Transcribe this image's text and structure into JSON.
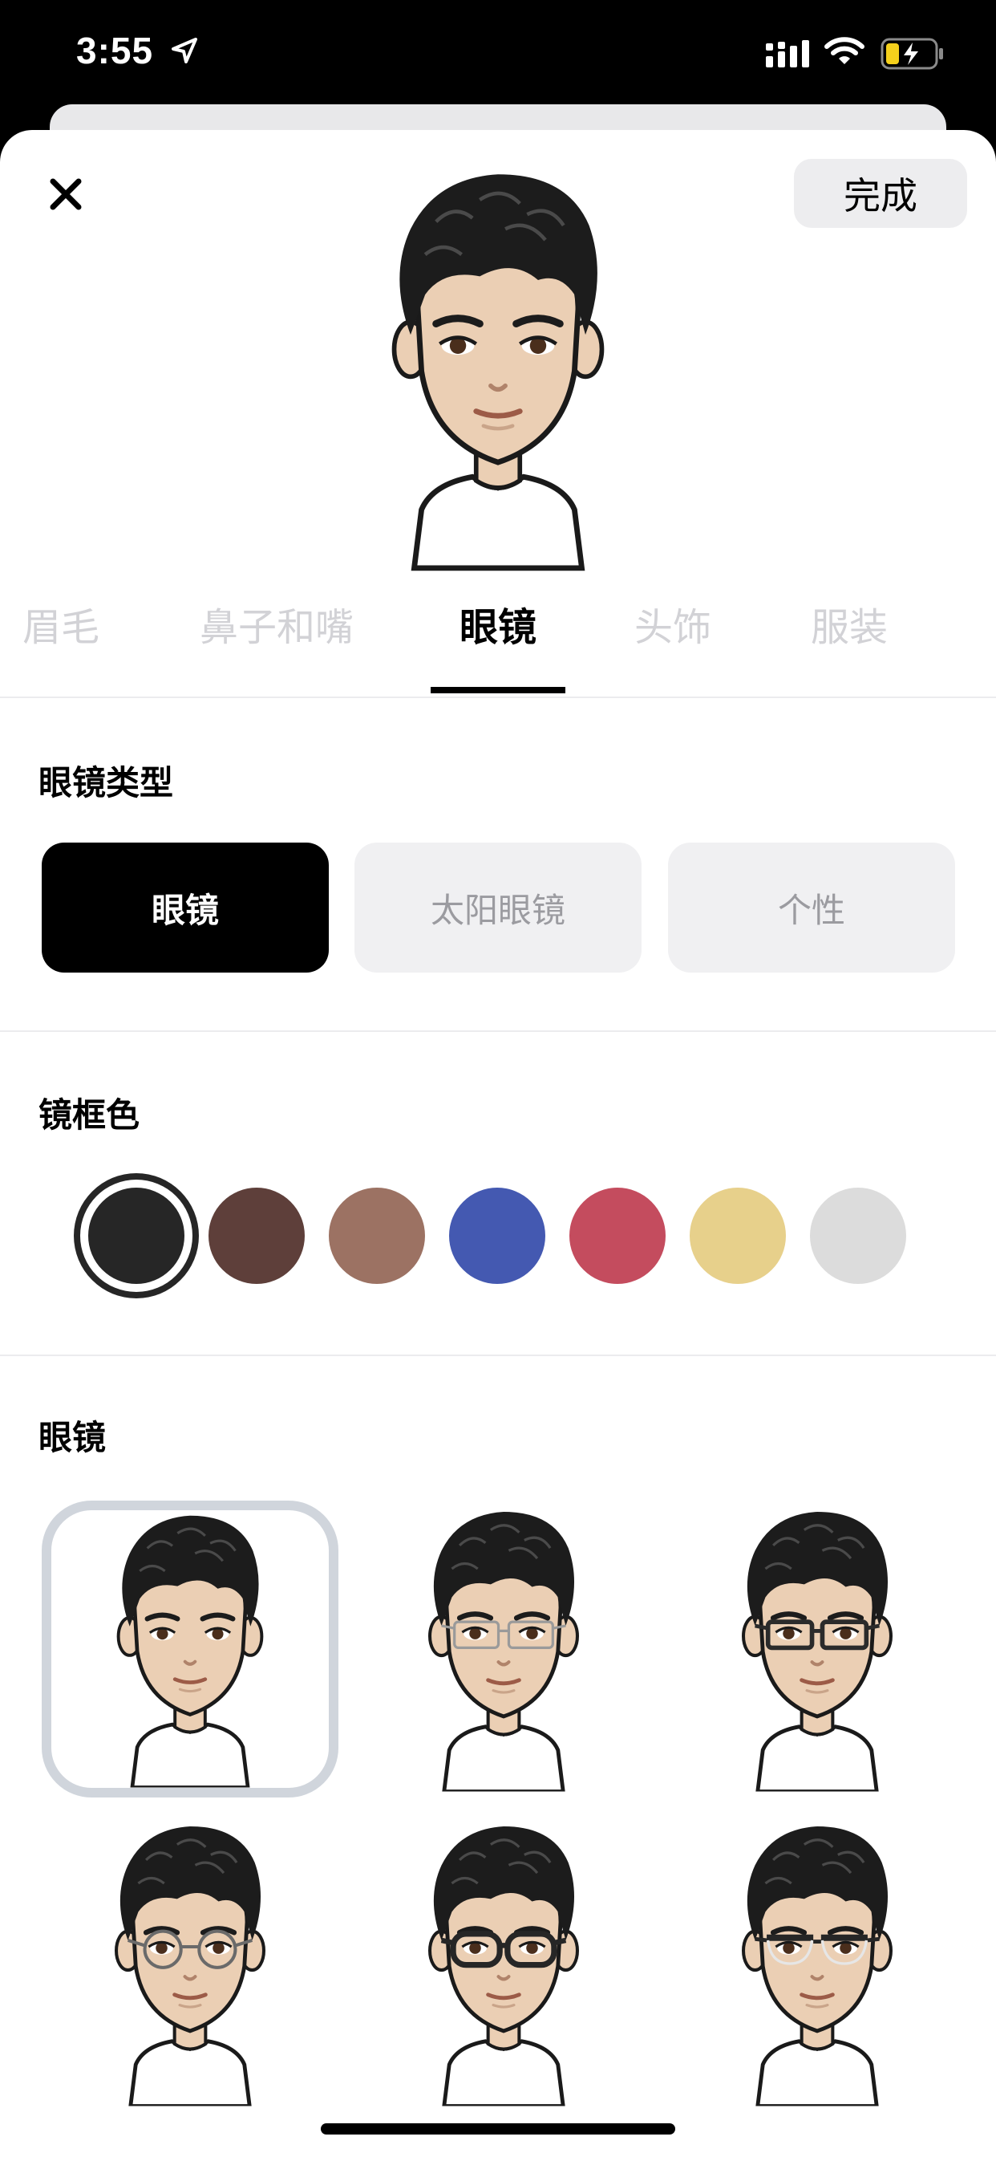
{
  "status": {
    "time": "3:55"
  },
  "header": {
    "done_label": "完成"
  },
  "tabs": [
    {
      "label": "眉毛",
      "active": false
    },
    {
      "label": "鼻子和嘴",
      "active": false
    },
    {
      "label": "眼镜",
      "active": true
    },
    {
      "label": "头饰",
      "active": false
    },
    {
      "label": "服装",
      "active": false
    }
  ],
  "glasses_type": {
    "title": "眼镜类型",
    "options": [
      {
        "label": "眼镜",
        "selected": true
      },
      {
        "label": "太阳眼镜",
        "selected": false
      },
      {
        "label": "个性",
        "selected": false
      }
    ]
  },
  "frame_color": {
    "title": "镜框色",
    "colors": [
      "#262626",
      "#5e3f3a",
      "#9c7263",
      "#4459b1",
      "#c44c5e",
      "#e7d08b",
      "#dcdcdc"
    ],
    "selected_index": 0
  },
  "glasses": {
    "title": "眼镜",
    "styles": [
      {
        "name": "none",
        "selected": true
      },
      {
        "name": "thin-silver-rectangle",
        "selected": false,
        "color": "#9a9a9a"
      },
      {
        "name": "dark-rectangle",
        "selected": false,
        "color": "#2b2b2b"
      },
      {
        "name": "round-wire",
        "selected": false,
        "color": "#6a6a6a"
      },
      {
        "name": "thick-round",
        "selected": false,
        "color": "#262626"
      },
      {
        "name": "browline",
        "selected": false,
        "color": "#262626"
      }
    ]
  },
  "colors": {
    "skin": "#ebcfb4",
    "hair": "#1c1c1c",
    "accent": "#000000"
  }
}
